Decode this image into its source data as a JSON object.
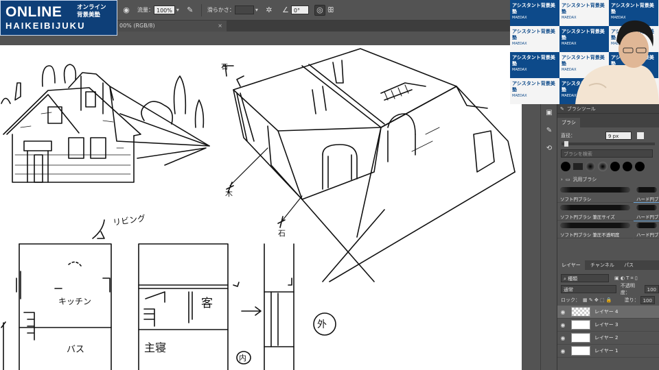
{
  "logo": {
    "main": "ONLINE",
    "sub": "HAIKEIBIJUKU",
    "jp_line1": "オンライン",
    "jp_line2": "背景美塾"
  },
  "options_bar": {
    "flow_label": "流量：",
    "flow_value": "100%",
    "smoothing_label": "滑らかさ：",
    "angle_value": "0°"
  },
  "document_tab": {
    "title": "00% (RGB/8)",
    "close": "×"
  },
  "canvas": {
    "annotations": [
      "石",
      "木",
      "石",
      "リビング",
      "キッチン",
      "バス",
      "客",
      "主寝",
      "外",
      "内"
    ]
  },
  "webcam": {
    "tile_text": "アシスタント背景美塾",
    "tile_sub": "MAEDAX"
  },
  "brush_panel": {
    "header": "ブラシツール",
    "tab": "ブラシ",
    "size_label": "直径：",
    "size_value": "9 px",
    "search_placeholder": "ブラシを検索",
    "group_name": "汎用ブラシ",
    "presets": [
      {
        "label": "ソフト円ブラシ"
      },
      {
        "label": "ハード円ブラシ"
      },
      {
        "label": "ソフト円ブラシ 筆圧サイズ"
      },
      {
        "label": "ハード円ブラ"
      },
      {
        "label": "ソフト円ブラシ 筆圧不透明度"
      },
      {
        "label": "ハード円ブ"
      }
    ]
  },
  "layers_panel": {
    "tabs": [
      "レイヤー",
      "チャンネル",
      "パス"
    ],
    "kind_label": "種類",
    "blend_mode": "通常",
    "opacity_label": "不透明度：",
    "opacity_value": "100",
    "lock_label": "ロック：",
    "fill_label": "塗り：",
    "fill_value": "100",
    "layers": [
      {
        "name": "レイヤー 4",
        "selected": true
      },
      {
        "name": "レイヤー 3",
        "selected": false
      },
      {
        "name": "レイヤー 2",
        "selected": false
      },
      {
        "name": "レイヤー 1",
        "selected": false
      }
    ]
  }
}
